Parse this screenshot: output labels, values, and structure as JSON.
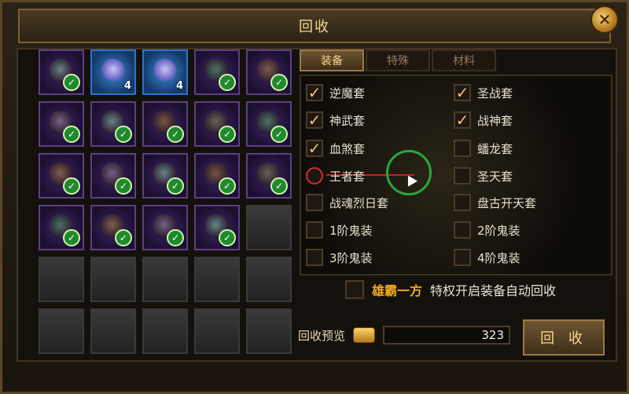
{
  "window": {
    "title": "回收",
    "close_icon": "close-icon"
  },
  "tabs": [
    "装备",
    "特殊",
    "材料"
  ],
  "options_left": [
    {
      "label": "逆魔套",
      "checked": true
    },
    {
      "label": "神武套",
      "checked": true
    },
    {
      "label": "血煞套",
      "checked": true
    },
    {
      "label": "王者套",
      "checked": false,
      "focused": true
    },
    {
      "label": "战魂烈日套",
      "checked": false
    },
    {
      "label": "1阶鬼装",
      "checked": false
    },
    {
      "label": "3阶鬼装",
      "checked": false
    }
  ],
  "options_right": [
    {
      "label": "圣战套",
      "checked": true
    },
    {
      "label": "战神套",
      "checked": true
    },
    {
      "label": "蟠龙套",
      "checked": false
    },
    {
      "label": "圣天套",
      "checked": false
    },
    {
      "label": "盘古开天套",
      "checked": false
    },
    {
      "label": "2阶鬼装",
      "checked": false
    },
    {
      "label": "4阶鬼装",
      "checked": false
    }
  ],
  "privilege": {
    "highlight": "雄霸一方",
    "rest": "特权开启装备自动回收"
  },
  "preview": {
    "label": "回收预览",
    "value": "323"
  },
  "recycle_button": "回 收",
  "inventory": {
    "rows": [
      [
        {
          "type": "purple",
          "checked": true
        },
        {
          "type": "blue",
          "count": "4"
        },
        {
          "type": "blue",
          "count": "4"
        },
        {
          "type": "purple",
          "checked": true
        },
        {
          "type": "purple",
          "checked": true
        }
      ],
      [
        {
          "type": "purple",
          "checked": true
        },
        {
          "type": "purple",
          "checked": true
        },
        {
          "type": "purple",
          "checked": true
        },
        {
          "type": "purple",
          "checked": true
        },
        {
          "type": "purple",
          "checked": true
        }
      ],
      [
        {
          "type": "purple",
          "checked": true
        },
        {
          "type": "purple",
          "checked": true
        },
        {
          "type": "purple",
          "checked": true
        },
        {
          "type": "purple",
          "checked": true
        },
        {
          "type": "purple",
          "checked": true
        }
      ],
      [
        {
          "type": "purple",
          "checked": true
        },
        {
          "type": "purple",
          "checked": true
        },
        {
          "type": "purple",
          "checked": true
        },
        {
          "type": "purple",
          "checked": true
        },
        {
          "type": "empty"
        }
      ],
      [
        {
          "type": "empty"
        },
        {
          "type": "empty"
        },
        {
          "type": "empty"
        },
        {
          "type": "empty"
        },
        {
          "type": "empty"
        }
      ],
      [
        {
          "type": "empty"
        },
        {
          "type": "empty"
        },
        {
          "type": "empty"
        },
        {
          "type": "empty"
        },
        {
          "type": "empty"
        }
      ]
    ]
  }
}
